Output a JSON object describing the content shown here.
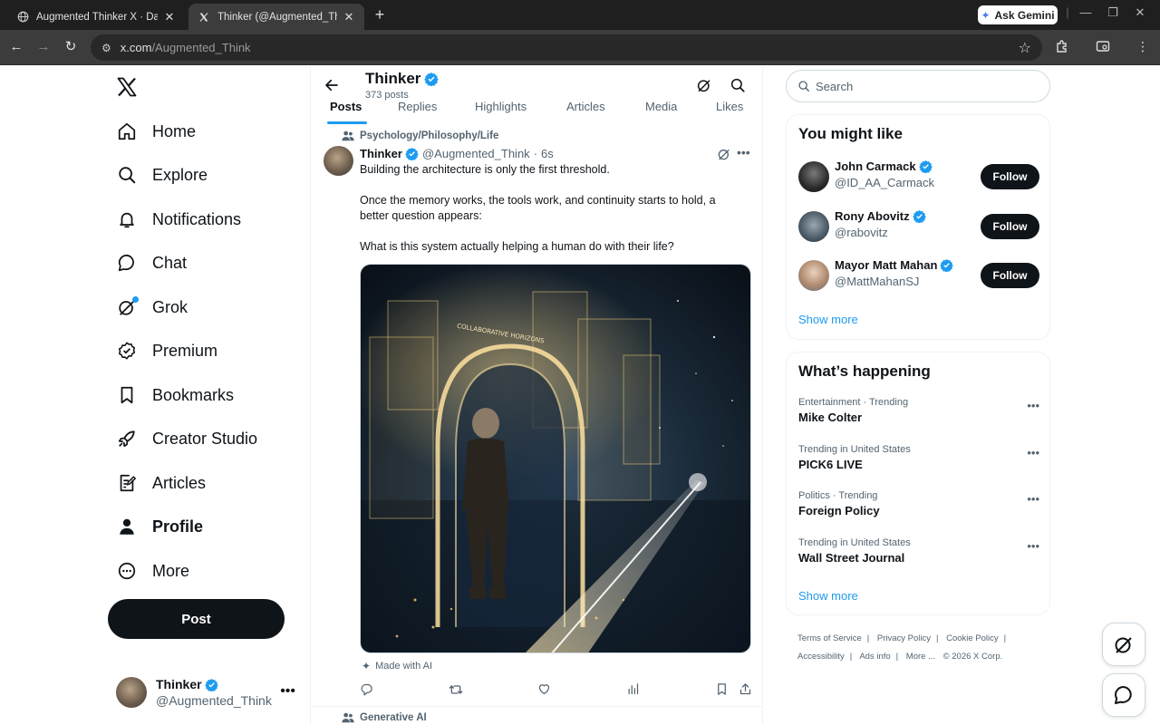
{
  "browser": {
    "tabs": [
      {
        "title": "Augmented Thinker X · Daily Po",
        "active": false
      },
      {
        "title": "Thinker (@Augmented_Think) /",
        "active": true
      }
    ],
    "gemini_label": "Ask Gemini",
    "url_host": "x.com",
    "url_path": "/Augmented_Think"
  },
  "leftnav": {
    "items": [
      {
        "label": "Home",
        "icon": "home-icon"
      },
      {
        "label": "Explore",
        "icon": "search-icon"
      },
      {
        "label": "Notifications",
        "icon": "bell-icon"
      },
      {
        "label": "Chat",
        "icon": "chat-bubble-icon"
      },
      {
        "label": "Grok",
        "icon": "grok-icon"
      },
      {
        "label": "Premium",
        "icon": "premium-badge-icon"
      },
      {
        "label": "Bookmarks",
        "icon": "bookmark-icon"
      },
      {
        "label": "Creator Studio",
        "icon": "rocket-icon"
      },
      {
        "label": "Articles",
        "icon": "articles-icon"
      },
      {
        "label": "Profile",
        "icon": "person-icon"
      },
      {
        "label": "More",
        "icon": "more-circle-icon"
      }
    ],
    "post_label": "Post",
    "account": {
      "name": "Thinker",
      "handle": "@Augmented_Think"
    }
  },
  "profile": {
    "name": "Thinker",
    "post_count": "373 posts",
    "tabs": [
      "Posts",
      "Replies",
      "Highlights",
      "Articles",
      "Media",
      "Likes"
    ]
  },
  "tweet": {
    "context": "Psychology/Philosophy/Life",
    "name": "Thinker",
    "handle": "@Augmented_Think",
    "time": "6s",
    "paragraphs": [
      "Building the architecture is only the first threshold.",
      "Once the memory works, the tools work, and continuity starts to hold, a better question appears:",
      "What is this system actually helping a human do with their life?"
    ],
    "image_caption": "COLLABORATIVE HORIZONS",
    "ai_label": "Made with AI"
  },
  "next_tweet": {
    "context": "Generative AI"
  },
  "sidebar": {
    "search_placeholder": "Search",
    "might_like_title": "You might like",
    "suggestions": [
      {
        "name": "John Carmack",
        "handle": "@ID_AA_Carmack",
        "follow": "Follow"
      },
      {
        "name": "Rony Abovitz",
        "handle": "@rabovitz",
        "follow": "Follow"
      },
      {
        "name": "Mayor Matt Mahan",
        "handle": "@MattMahanSJ",
        "follow": "Follow"
      }
    ],
    "show_more": "Show more",
    "happening_title": "What’s happening",
    "trends": [
      {
        "context": "Entertainment · Trending",
        "title": "Mike Colter"
      },
      {
        "context": "Trending in United States",
        "title": "PICK6 LIVE"
      },
      {
        "context": "Politics · Trending",
        "title": "Foreign Policy"
      },
      {
        "context": "Trending in United States",
        "title": "Wall Street Journal"
      }
    ],
    "show_more_2": "Show more",
    "footer": [
      "Terms of Service",
      "Privacy Policy",
      "Cookie Policy",
      "Accessibility",
      "Ads info",
      "More ...",
      "© 2026 X Corp."
    ]
  },
  "colors": {
    "accent": "#1d9bf0",
    "text": "#0f1419",
    "muted": "#536471"
  }
}
